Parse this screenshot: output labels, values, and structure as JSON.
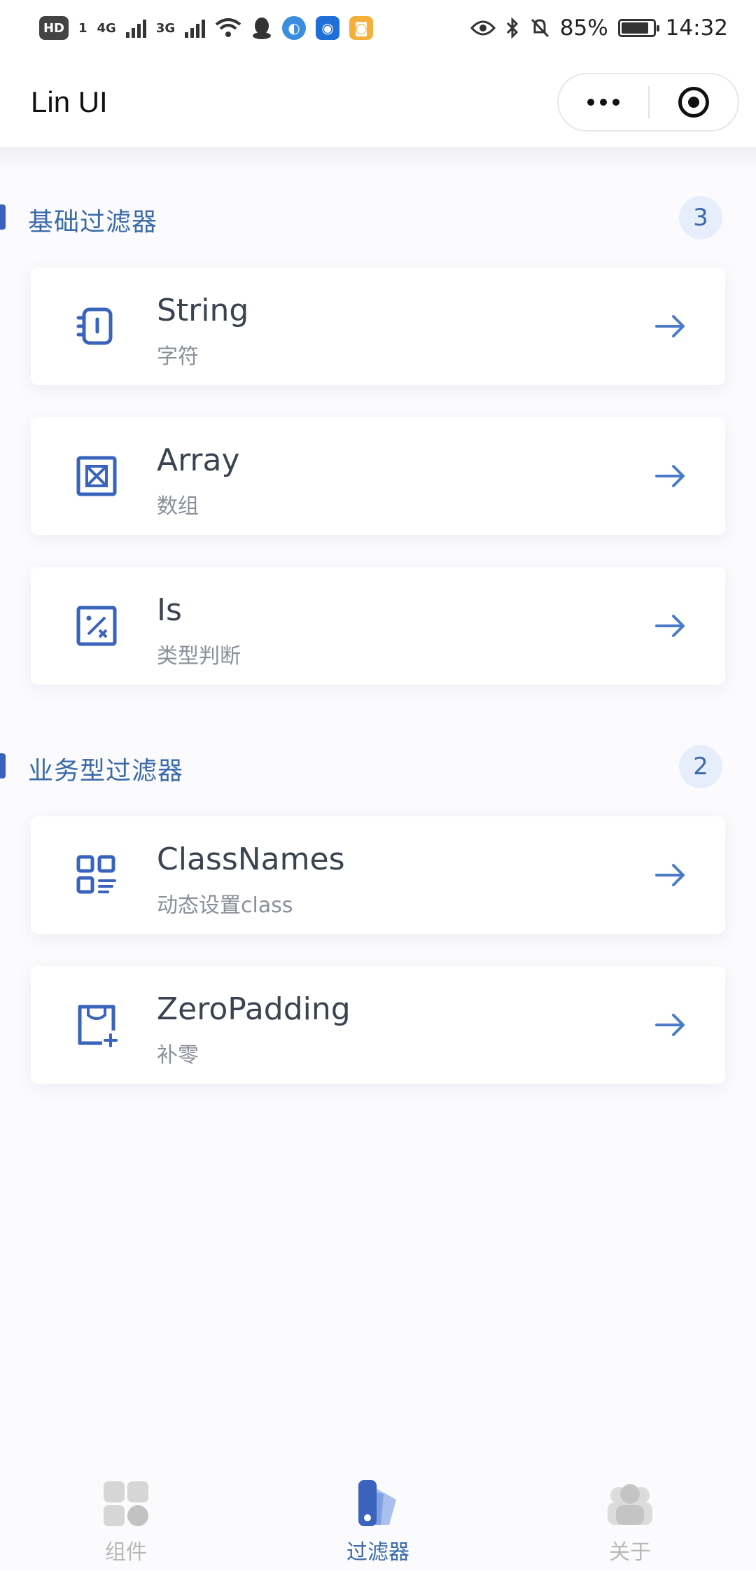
{
  "status_bar": {
    "hd_badge": "HD",
    "hd_sub": "1",
    "sim1": "4G",
    "sim2": "3G",
    "battery_percent": "85%",
    "time": "14:32"
  },
  "nav": {
    "title": "Lin UI"
  },
  "sections": [
    {
      "title": "基础过滤器",
      "count": "3",
      "items": [
        {
          "name": "String",
          "desc": "字符",
          "icon": "notebook-icon"
        },
        {
          "name": "Array",
          "desc": "数组",
          "icon": "array-box-icon"
        },
        {
          "name": "Is",
          "desc": "类型判断",
          "icon": "percent-box-icon"
        }
      ]
    },
    {
      "title": "业务型过滤器",
      "count": "2",
      "items": [
        {
          "name": "ClassNames",
          "desc": "动态设置class",
          "icon": "qr-grid-icon"
        },
        {
          "name": "ZeroPadding",
          "desc": "补零",
          "icon": "box-plus-icon"
        }
      ]
    }
  ],
  "tabbar": {
    "tabs": [
      {
        "label": "组件",
        "active": false,
        "icon": "components-icon"
      },
      {
        "label": "过滤器",
        "active": true,
        "icon": "filter-icon"
      },
      {
        "label": "关于",
        "active": false,
        "icon": "about-icon"
      }
    ]
  },
  "colors": {
    "accent": "#3a6aa8",
    "icon_blue": "#3963bc",
    "arrow_blue": "#4a7bc8",
    "muted": "#b8b8b8"
  }
}
